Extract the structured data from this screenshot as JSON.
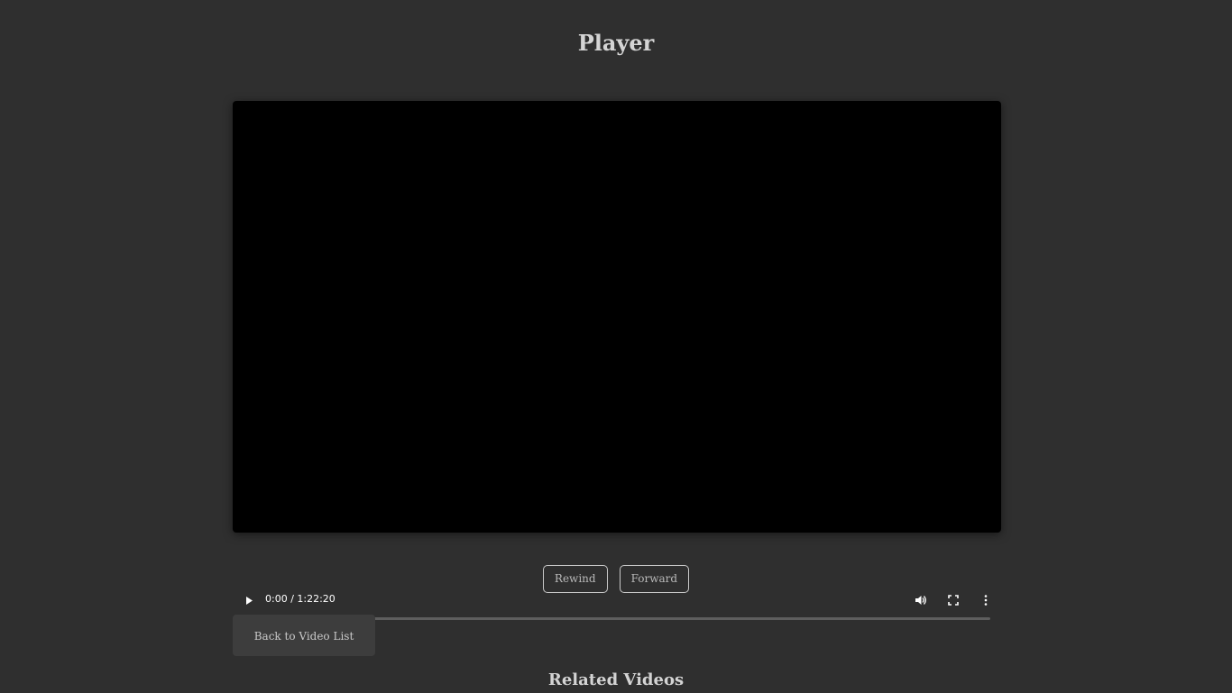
{
  "page": {
    "title": "Player"
  },
  "player": {
    "current_time": "0:00",
    "duration": "1:22:20",
    "time_display": "0:00 / 1:22:20",
    "progress_fraction": 0,
    "icons": {
      "play": "play-icon",
      "volume": "volume-icon",
      "fullscreen": "fullscreen-icon",
      "more": "more-options-icon"
    }
  },
  "controls": {
    "rewind_label": "Rewind",
    "forward_label": "Forward"
  },
  "navigation": {
    "back_label": "Back to Video List"
  },
  "related": {
    "title": "Related Videos"
  },
  "colors": {
    "background": "#2f2f2f",
    "player_background": "#000000",
    "heading_text": "#d4d4d4"
  }
}
